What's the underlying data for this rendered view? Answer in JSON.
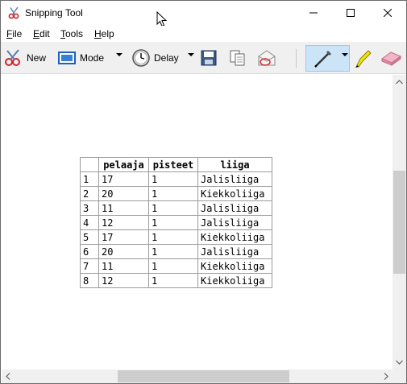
{
  "window": {
    "title": "Snipping Tool"
  },
  "menu": [
    {
      "label": "File",
      "mnemonic": "F"
    },
    {
      "label": "Edit",
      "mnemonic": "E"
    },
    {
      "label": "Tools",
      "mnemonic": "T"
    },
    {
      "label": "Help",
      "mnemonic": "H"
    }
  ],
  "toolbar": {
    "new_label": "New",
    "mode_label": "Mode",
    "delay_label": "Delay",
    "icons": [
      "scissors-icon",
      "mode-icon",
      "clock-icon",
      "save-icon",
      "copy-icon",
      "send-icon",
      "pen-icon",
      "highlighter-icon",
      "eraser-icon"
    ]
  },
  "table": {
    "headers": [
      "",
      "pelaaja",
      "pisteet",
      "liiga"
    ],
    "rows": [
      [
        "1",
        "17",
        "1",
        "Jalisliiga"
      ],
      [
        "2",
        "20",
        "1",
        "Kiekkoliiga"
      ],
      [
        "3",
        "11",
        "1",
        "Jalisliiga"
      ],
      [
        "4",
        "12",
        "1",
        "Jalisliiga"
      ],
      [
        "5",
        "17",
        "1",
        "Kiekkoliiga"
      ],
      [
        "6",
        "20",
        "1",
        "Jalisliiga"
      ],
      [
        "7",
        "11",
        "1",
        "Kiekkoliiga"
      ],
      [
        "8",
        "12",
        "1",
        "Kiekkoliiga"
      ]
    ]
  },
  "colors": {
    "selected_tool_bg": "#cce4f7",
    "toolbar_bg": "#f0f0f0",
    "scrollbar_thumb": "#cdcdcd"
  }
}
